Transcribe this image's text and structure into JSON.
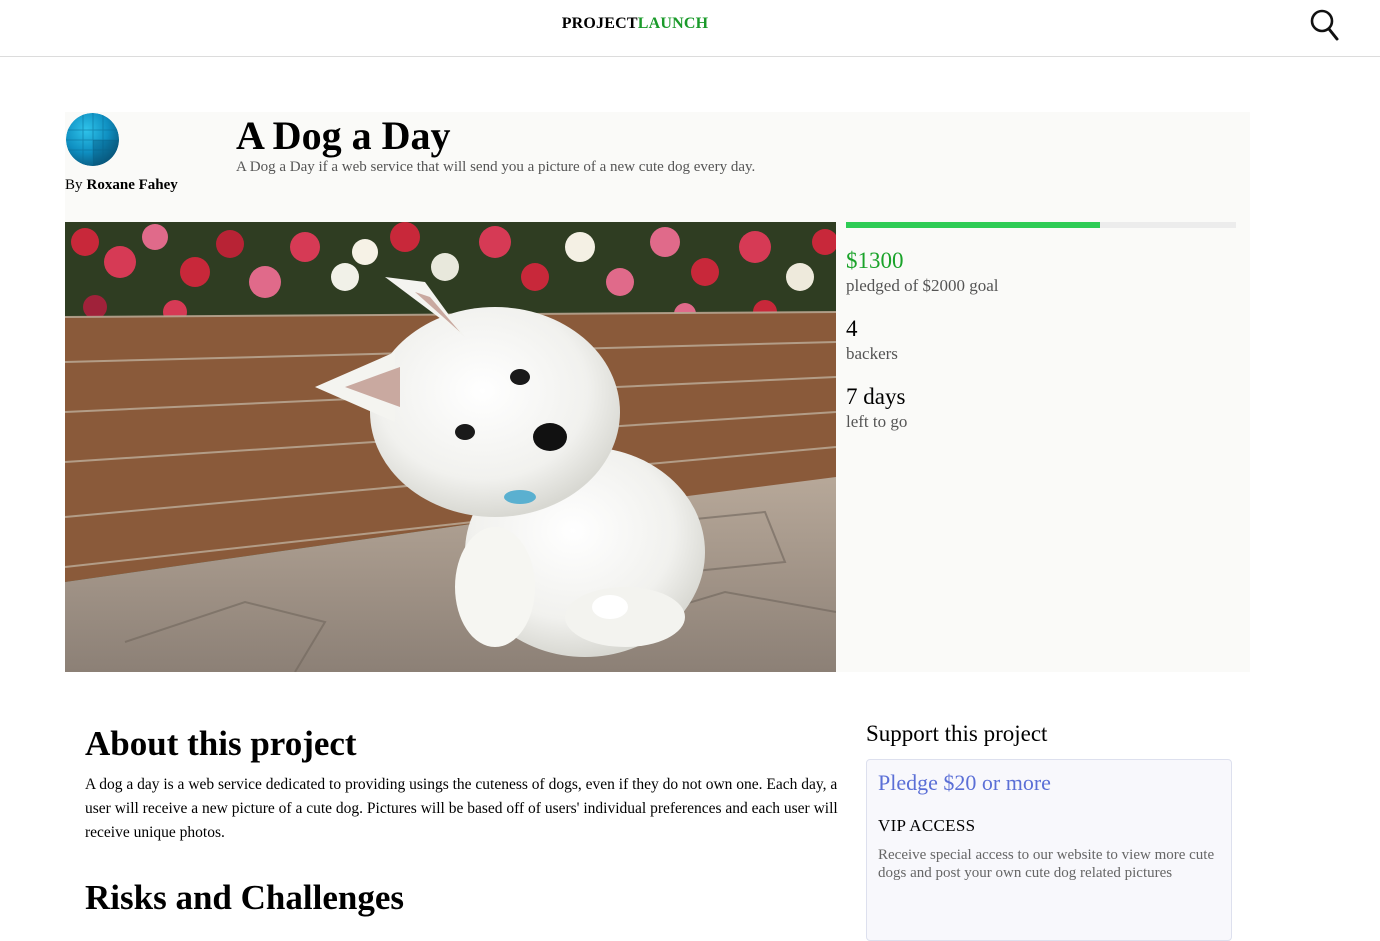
{
  "header": {
    "logo_part1": "PROJECT",
    "logo_part2": "LAUNCH",
    "logo_accent_color": "#1a9a2a",
    "search_icon": "search-icon"
  },
  "project": {
    "by_label": "By",
    "author": "Roxane Fahey",
    "title": "A Dog a Day",
    "subtitle": "A Dog a Day if a web service that will send you a picture of a new cute dog every day.",
    "avatar_icon": "avatar-globe-icon",
    "image_alt": "West Highland terrier puppy tilting its head in front of a brick flower bed"
  },
  "funding": {
    "pledged": "$1300",
    "pledged_label": "pledged of $2000 goal",
    "progress_fraction": 0.65,
    "progress_color": "#2ecc55",
    "backers": "4",
    "backers_label": "backers",
    "days": "7 days",
    "days_label": "left to go"
  },
  "about": {
    "heading": "About this project",
    "text": "A dog a day is a web service dedicated to providing usings the cuteness of dogs, even if they do not own one. Each day, a user will receive a new picture of a cute dog. Pictures will be based off of users' individual preferences and each user will receive unique photos."
  },
  "risks": {
    "heading": "Risks and Challenges"
  },
  "support": {
    "heading": "Support this project",
    "reward": {
      "amount": "Pledge $20 or more",
      "name": "VIP ACCESS",
      "description": "Receive special access to our website to view more cute dogs and post your own cute dog related pictures",
      "amount_color": "#5b6fd6"
    }
  }
}
